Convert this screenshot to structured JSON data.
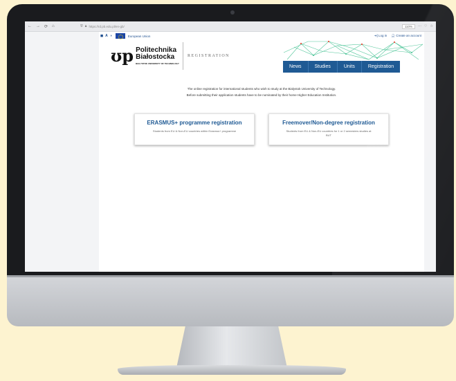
{
  "browser": {
    "nav": [
      "←",
      "→",
      "⟳",
      "⌂"
    ],
    "url": "https://rd.pb.edu.pl/en-gb/",
    "zoom": "110%",
    "controls": [
      "⋯",
      "♡",
      "☆"
    ]
  },
  "utility": {
    "accessibility": [
      "◼",
      "A",
      "◑"
    ],
    "eu_label": "European Union",
    "login": "Log in",
    "create_account": "Create an account"
  },
  "header": {
    "logo_mark": "ʊp",
    "logo_line1": "Politechnika",
    "logo_line2": "Białostocka",
    "logo_sub": "BIALYSTOK UNIVERSITY OF TECHNOLOGY",
    "section_label": "REGISTRATION"
  },
  "menu": {
    "items": [
      "News",
      "Studies",
      "Units",
      "Registration"
    ]
  },
  "intro": {
    "line1": "The online registration for international students who wish to study at the Bialystok University of Technology.",
    "line2": "Before submitting their application students have to be nominated by their home Higher Education Institution."
  },
  "cards": [
    {
      "title": "ERASMUS+ programme registration",
      "desc": "Students from EU & Non-EU countries within Erasmus+ programme"
    },
    {
      "title": "Freemover/Non-degree registration",
      "desc": "Students from EU & Non-EU countries for 1 or 2 semesters studies at BUT"
    }
  ],
  "colors": {
    "accent": "#1f5a94",
    "network_lines": "#3cbf8e"
  }
}
